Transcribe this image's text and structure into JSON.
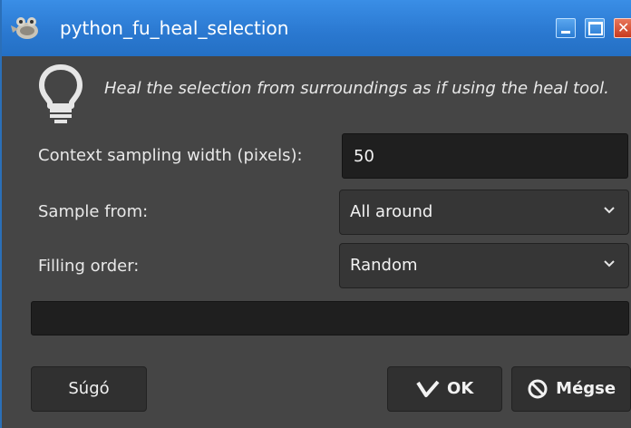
{
  "window": {
    "title": "python_fu_heal_selection",
    "app_icon": "gimp-wilber-icon",
    "controls": [
      "minimize-icon",
      "maximize-icon",
      "close-icon"
    ]
  },
  "dialog": {
    "hint_icon": "lightbulb-icon",
    "description": "Heal the selection from surroundings as if using the heal tool."
  },
  "fields": {
    "context_width": {
      "label": "Context sampling width (pixels):",
      "value": "50"
    },
    "sample_from": {
      "label": "Sample from:",
      "value": "All around"
    },
    "filling_order": {
      "label": "Filling order:",
      "value": "Random"
    }
  },
  "progress": {
    "text": ""
  },
  "buttons": {
    "help": "Súgó",
    "ok": "OK",
    "ok_icon": "checkmark-icon",
    "cancel": "Mégse",
    "cancel_icon": "cancel-circle-icon"
  },
  "colors": {
    "titlebar": "#2a78d0",
    "dialog_bg": "#454545",
    "field_bg": "#1f1f1f",
    "text": "#e8e8e8"
  }
}
